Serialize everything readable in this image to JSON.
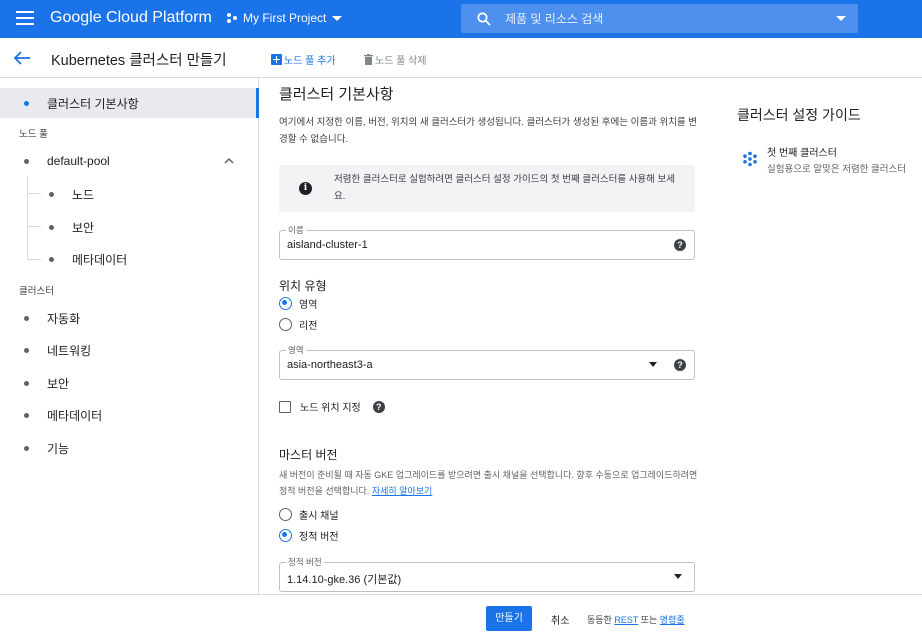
{
  "topbar": {
    "brand": "Google Cloud Platform",
    "project": "My First Project",
    "search_placeholder": "제품 및 리소스 검색",
    "accent": "#1a73e8"
  },
  "subheader": {
    "title": "Kubernetes 클러스터 만들기",
    "add_node_pool": "노드 풀 추가",
    "delete_node_pool": "노드 풀 삭제"
  },
  "nav": {
    "cluster_basics": "클러스터 기본사항",
    "node_pools_section": "노드 풀",
    "pool_name": "default-pool",
    "pool_children": [
      "노드",
      "보안",
      "메타데이터"
    ],
    "cluster_section": "클러스터",
    "cluster_items": [
      "자동화",
      "네트워킹",
      "보안",
      "메타데이터",
      "기능"
    ]
  },
  "main": {
    "title": "클러스터 기본사항",
    "description": "여기에서 지정한 이름, 버전, 위치의 새 클러스터가 생성됩니다. 클러스터가 생성된 후에는 이름과 위치를 변경할 수 없습니다.",
    "info": "저렴한 클러스터로 실험하려면 클러스터 설정 가이드의 첫 번째 클러스터를 사용해 보세요.",
    "name_label": "이름",
    "name_value": "aisland-cluster-1",
    "location_type_heading": "위치 유형",
    "location_options": [
      "영역",
      "리전"
    ],
    "zone_label": "영역",
    "zone_value": "asia-northeast3-a",
    "node_locations_label": "노드 위치 지정",
    "master_version_heading": "마스터 버전",
    "master_description": "새 버전이 준비될 때 자동 GKE 업그레이드를 받으려면 출시 채널을 선택합니다. 향후 수동으로 업그레이드하려면 정적 버전을 선택합니다.",
    "learn_more": "자세히 알아보기",
    "version_options": [
      "출시 채널",
      "정적 버전"
    ],
    "static_version_label": "정적 버전",
    "static_version_value": "1.14.10-gke.36 (기본값)"
  },
  "guide": {
    "title": "클러스터 설정 가이드",
    "item_title": "첫 번째 클러스터",
    "item_subtitle": "실험용으로 알맞은 저렴한 클러스터"
  },
  "footer": {
    "create": "만들기",
    "cancel": "취소",
    "equivalent_prefix": "동등한",
    "rest": "REST",
    "or": "또는",
    "command_line": "명령줄"
  }
}
